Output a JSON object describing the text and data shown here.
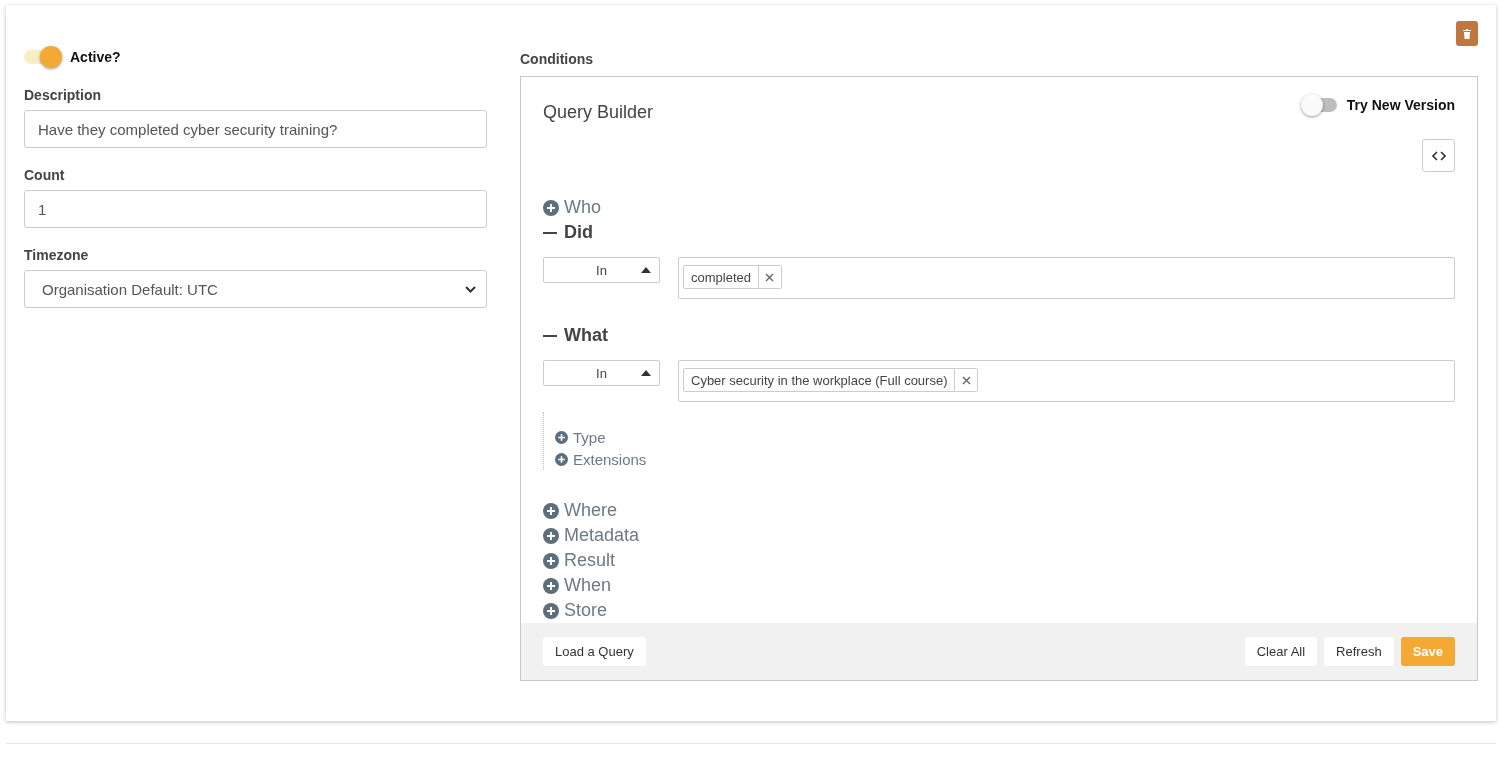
{
  "active": {
    "label": "Active?",
    "on": true
  },
  "fields": [
    {
      "kind": "text",
      "label": "Description",
      "value": "Have they completed cyber security training?"
    },
    {
      "kind": "text",
      "label": "Count",
      "value": "1"
    },
    {
      "kind": "select",
      "label": "Timezone",
      "value": "Organisation Default: UTC"
    }
  ],
  "conditions": {
    "title": "Conditions",
    "builder_title": "Query Builder",
    "new_version": {
      "label": "Try New Version",
      "on": false
    },
    "sections": [
      {
        "label": "Who",
        "expanded": false
      },
      {
        "label": "Did",
        "expanded": true,
        "operator": "In",
        "tags": [
          "completed"
        ]
      },
      {
        "label": "What",
        "expanded": true,
        "operator": "In",
        "tags": [
          "Cyber security in the workplace (Full course)"
        ],
        "children": [
          {
            "label": "Type",
            "expanded": false
          },
          {
            "label": "Extensions",
            "expanded": false
          }
        ]
      },
      {
        "label": "Where",
        "expanded": false
      },
      {
        "label": "Metadata",
        "expanded": false
      },
      {
        "label": "Result",
        "expanded": false
      },
      {
        "label": "When",
        "expanded": false
      },
      {
        "label": "Store",
        "expanded": false
      }
    ],
    "footer_left": [
      {
        "label": "Load a Query",
        "primary": false
      }
    ],
    "footer_right": [
      {
        "label": "Clear All",
        "primary": false
      },
      {
        "label": "Refresh",
        "primary": false
      },
      {
        "label": "Save",
        "primary": true
      }
    ]
  }
}
